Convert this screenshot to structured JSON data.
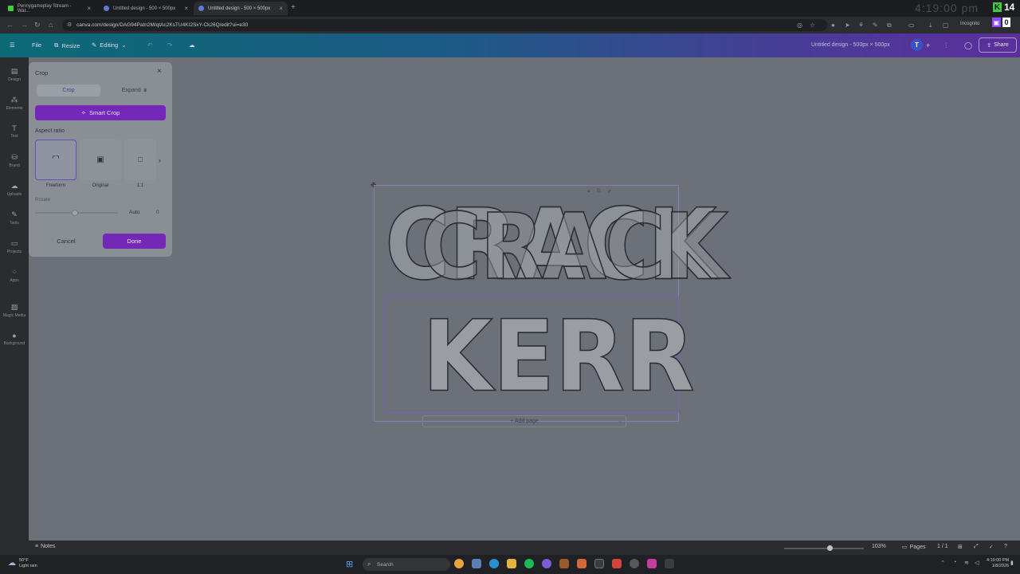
{
  "browser": {
    "tabs": [
      {
        "title": "Pennygameplay Stream - Wat...",
        "favicon": "kick-icon",
        "active": false
      },
      {
        "title": "Untitled design - 500 × 500px",
        "favicon": "canva-icon",
        "active": false
      },
      {
        "title": "Untitled design - 500 × 500px",
        "favicon": "canva-icon",
        "active": true
      }
    ],
    "url": "canva.com/design/DAG94PaIn2M/qtAc2KsTU4KI2SxY-Ck26Q/edit?ui=e30",
    "incognito_label": "Incognito",
    "overlay_clock": "4:19:00 pm",
    "kick_overlay_count": "14",
    "twitch_overlay_count": "0"
  },
  "canva_header": {
    "file_label": "File",
    "resize_label": "Resize",
    "editing_label": "Editing",
    "doc_title": "Untitled design - 500px × 500px",
    "avatar_initial": "T",
    "share_label": "Share",
    "gradient_colors": [
      "#0b6a76",
      "#1d5a86",
      "#4b3a98",
      "#5b2f9a"
    ]
  },
  "rail": {
    "items": [
      {
        "label": "Design",
        "icon": "design-icon"
      },
      {
        "label": "Elements",
        "icon": "elements-icon"
      },
      {
        "label": "Text",
        "icon": "text-icon"
      },
      {
        "label": "Brand",
        "icon": "brand-icon"
      },
      {
        "label": "Uploads",
        "icon": "uploads-icon"
      },
      {
        "label": "Tools",
        "icon": "tools-icon"
      },
      {
        "label": "Projects",
        "icon": "projects-icon"
      },
      {
        "label": "Apps",
        "icon": "apps-icon"
      },
      {
        "label": "Magic Media",
        "icon": "magic-media-icon"
      },
      {
        "label": "Background",
        "icon": "background-icon"
      }
    ]
  },
  "crop_panel": {
    "title": "Crop",
    "tabs": [
      "Crop",
      "Expand"
    ],
    "smart_crop_label": "Smart Crop",
    "aspect_ratio_label": "Aspect ratio",
    "aspect_options": [
      {
        "label": "Freeform",
        "icon": "freeform-icon",
        "selected": true
      },
      {
        "label": "Original",
        "icon": "image-icon",
        "selected": false
      },
      {
        "label": "1:1",
        "icon": "square-icon",
        "selected": false
      }
    ],
    "rotate_label": "Rotate",
    "rotate_auto": "Auto",
    "rotate_value": "0",
    "cancel_label": "Cancel",
    "done_label": "Done",
    "accent": "#7328b8"
  },
  "canvas": {
    "line1": "CRACK",
    "line2": "KERR",
    "add_page_label": "+ Add page"
  },
  "footer": {
    "notes_label": "Notes",
    "zoom": "103%",
    "pages_label": "Pages",
    "page_count": "1 / 1"
  },
  "taskbar": {
    "weather_temp": "50°F",
    "weather_desc": "Light rain",
    "search_placeholder": "Search",
    "time": "4:19:00 PM",
    "date": "1/8/2026"
  }
}
